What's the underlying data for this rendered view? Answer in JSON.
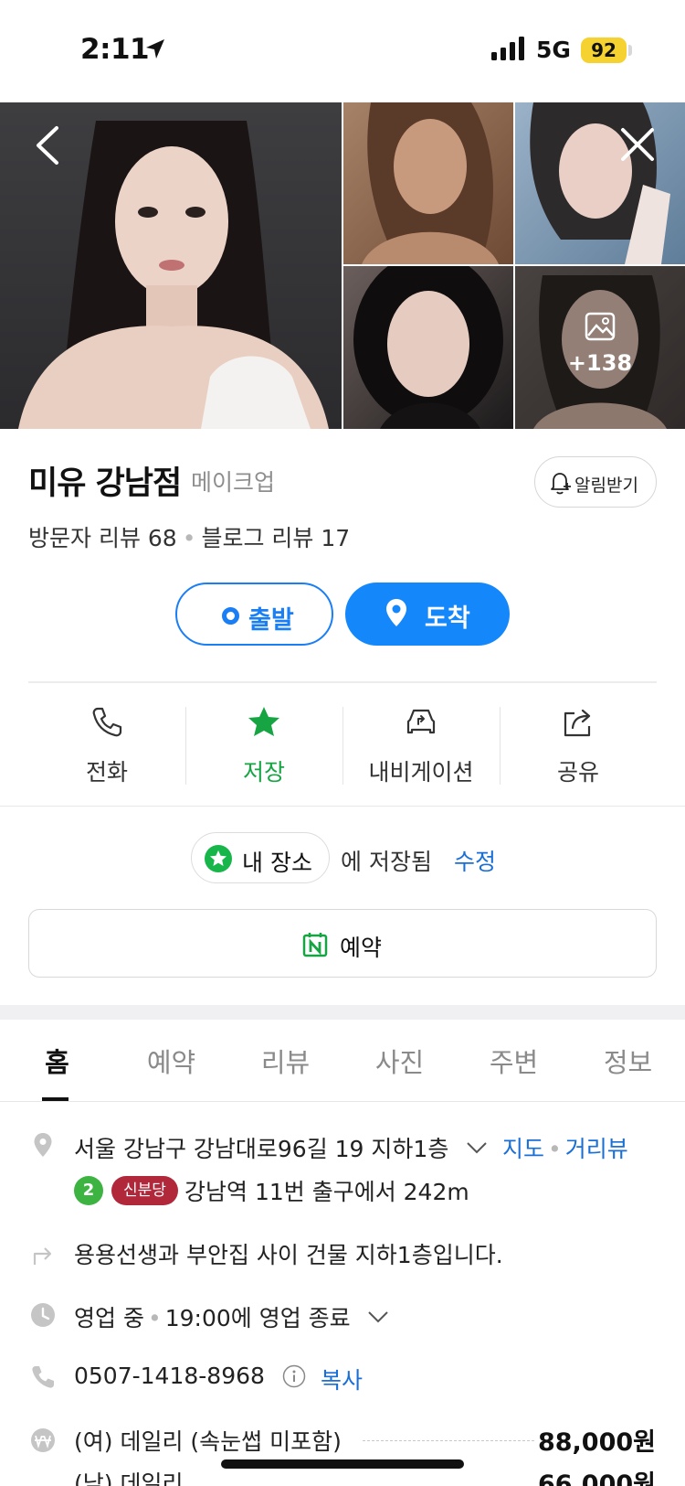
{
  "status_bar": {
    "time": "2:11",
    "network": "5G",
    "battery": "92"
  },
  "photos": {
    "more_count": "+138"
  },
  "place": {
    "name": "미유 강남점",
    "category": "메이크업",
    "alert_label": "알림받기",
    "visitor_reviews": "방문자 리뷰 68",
    "blog_reviews": "블로그 리뷰 17"
  },
  "route": {
    "depart_label": "출발",
    "arrive_label": "도착"
  },
  "actions": [
    {
      "label": "전화"
    },
    {
      "label": "저장"
    },
    {
      "label": "내비게이션"
    },
    {
      "label": "공유"
    }
  ],
  "saved": {
    "list_name": "내 장소",
    "text": "에 저장됨",
    "edit_label": "수정"
  },
  "reserve": {
    "label": "예약"
  },
  "tabs": [
    {
      "label": "홈"
    },
    {
      "label": "예약"
    },
    {
      "label": "리뷰"
    },
    {
      "label": "사진"
    },
    {
      "label": "주변"
    },
    {
      "label": "정보"
    }
  ],
  "info": {
    "address": "서울 강남구 강남대로96길 19 지하1층",
    "map_link": "지도",
    "street_view_link": "거리뷰",
    "subway_line": "2",
    "station_badge": "신분당",
    "station_text": "강남역 11번 출구에서 242m",
    "directions": "용용선생과 부안집 사이 건물 지하1층입니다.",
    "hours_status": "영업 중",
    "hours_text": "19:00에 영업 종료",
    "phone": "0507-1418-8968",
    "copy_label": "복사",
    "prices": [
      {
        "name": "(여) 데일리 (속눈썹 미포함)",
        "price": "88,000원"
      },
      {
        "name": "(남) 데일리",
        "price": "66,000원"
      }
    ]
  },
  "colors": {
    "primary_blue": "#1487fb",
    "saved_green": "#17a544",
    "link_blue": "#1a6fd6",
    "line2_green": "#3db442",
    "shinbundang_red": "#b1283b",
    "battery_yellow": "#f6d230"
  }
}
